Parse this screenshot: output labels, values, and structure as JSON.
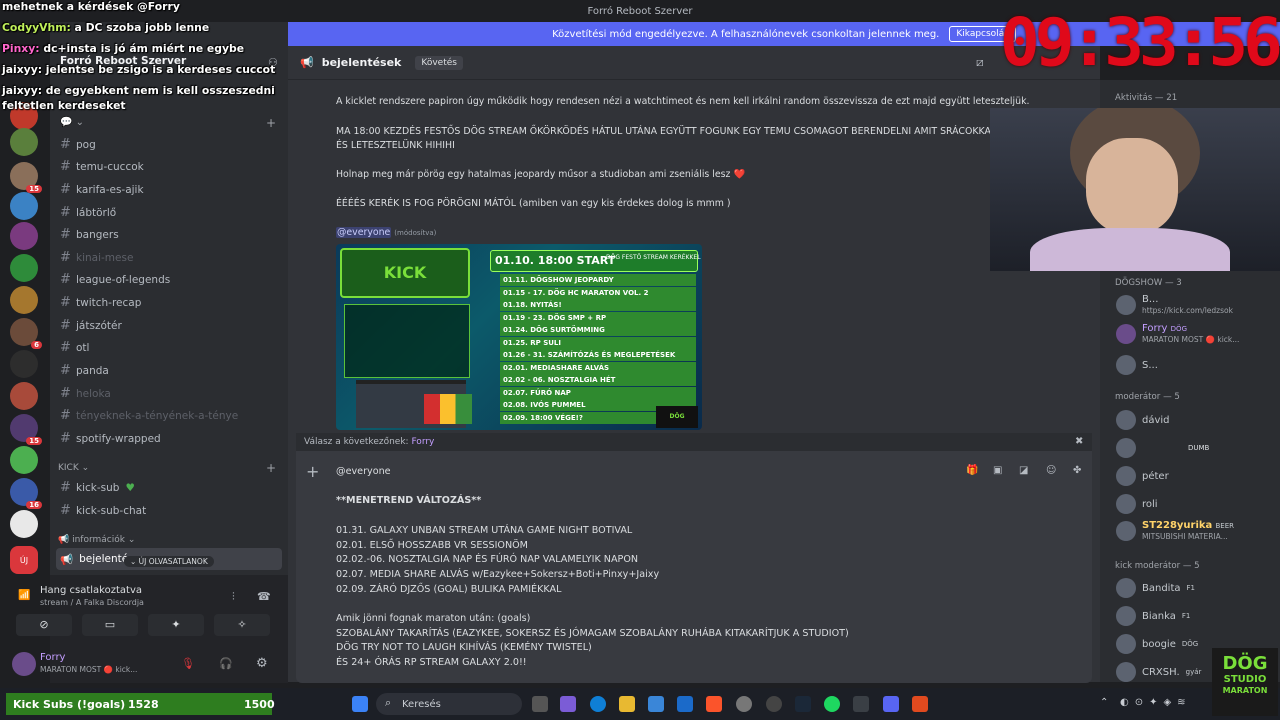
{
  "window": {
    "title": "Forró Reboot Szerver"
  },
  "banner": {
    "text": "Közvetítési mód engedélyezve. A felhasználónevek csonkoltan jelennek meg.",
    "button": "Kikapcsolás"
  },
  "overlay_chat": [
    {
      "text": "mehetnek a kérdések @Forry"
    },
    {
      "user": "CodyyVhm:",
      "text": " a DC szoba jobb lenne",
      "color": "#c0f05a"
    },
    {
      "user": "Pinxy:",
      "text": " dc+insta is jó ám miért ne egybe",
      "color": "#ff66cc"
    },
    {
      "user": "jaixyy:",
      "text": " jelentse be zsigo is a kerdeses cuccot",
      "color": "#ffffff"
    },
    {
      "user": "jaixyy:",
      "text": " de egyebkent nem is kell osszeszedni",
      "color": "#ffffff"
    },
    {
      "text": "feltetlen kerdeseket"
    }
  ],
  "clock": "09:33:56",
  "sidebar": {
    "server_name": "Forró Reboot Szerver",
    "category_kick": "KICK",
    "category_info": "információk",
    "channels": [
      {
        "name": "pog",
        "muted": false
      },
      {
        "name": "temu-cuccok",
        "muted": false
      },
      {
        "name": "karifa-es-ajik",
        "muted": false
      },
      {
        "name": "lábtörlő",
        "muted": false
      },
      {
        "name": "bangers",
        "muted": false
      },
      {
        "name": "kinai-mese",
        "muted": true
      },
      {
        "name": "league-of-legends",
        "muted": false
      },
      {
        "name": "twitch-recap",
        "muted": false
      },
      {
        "name": "játszótér",
        "muted": false
      },
      {
        "name": "otl",
        "muted": false
      },
      {
        "name": "panda",
        "muted": false
      },
      {
        "name": "heloka",
        "muted": true
      },
      {
        "name": "tényeknek-a-tényének-a-ténye",
        "muted": true
      },
      {
        "name": "spotify-wrapped",
        "muted": false
      }
    ],
    "kick_channels": [
      {
        "name": "kick-sub"
      },
      {
        "name": "kick-sub-chat"
      }
    ],
    "active_channel": "bejelenté",
    "unread_pill": "ÚJ OLVASATLANOK",
    "voice_status": "Hang csatlakoztatva",
    "voice_sub": "stream / A Falka Discordja",
    "user_name": "Forry",
    "user_status": "MARATON MOST 🔴 kick...",
    "server_badges": [
      "15",
      "6",
      "15",
      "16",
      "ÚJ"
    ]
  },
  "header": {
    "channel": "bejelentések",
    "follow": "Követés"
  },
  "messages": [
    "A kicklet rendszere papiron úgy működik hogy rendesen nézi a watchtimeot és nem kell irkálni random összevissza de ezt majd együtt leteszteljük.",
    "MA 18:00 KEZDÉS FESTŐS DÖG STREAM ŐKÖRKÖDÉS HÁTUL UTÁNA EGYÜTT FOGUNK EGY TEMU CSOMAGOT BERENDELNI AMIT SRÁCOKKAL",
    "ÉS LETESZTELÜNK HIHIHI",
    "Holnap meg már pörög egy hatalmas jeopardy műsor a studioban ami zseniális lesz ❤️",
    "ÉÉÉÉS KERÉK IS FOG PÖRÖGNI MÁTÓL (amiben van egy kis érdekes dolog is mmm )"
  ],
  "mention": {
    "text": "@everyone",
    "edited": "(módosítva)"
  },
  "schedule_image": {
    "logo": "KICK",
    "headline": "01.10. 18:00 START",
    "subhead": "DÖG FESTŐ STREAM KERÉKKEL",
    "items": [
      "01.11. DÖGSHOW JEOPARDY",
      "01.15 - 17. DÖG HC MARATON VOL. 2",
      "01.18. NYITÁS!",
      "01.19 - 23. DÖG SMP + RP",
      "01.24. DÖG SURTÖMMING",
      "01.25. RP SULI",
      "01.26 - 31. SZÁMÍTÓZÁS ÉS MEGLEPETÉSEK",
      "02.01. MEDIASHARE ALVÁS",
      "02.02 - 06. NOSZTALGIA HÉT",
      "02.07. FÚRÓ NAP",
      "02.08. IVÓS PUMMEL",
      "02.09. 18:00 VÉGE!?"
    ],
    "studio": "DÖG STUDIO"
  },
  "reply": {
    "label": "Válasz a következőnek:",
    "target": "Forry"
  },
  "composer_lines": [
    "@everyone",
    "",
    "**MENETREND VÁLTOZÁS**",
    "",
    "01.31. GALAXY UNBAN STREAM UTÁNA GAME NIGHT BOTIVAL",
    "02.01. ELSŐ HOSSZABB VR SESSIONÖM",
    "02.02.-06. NOSZTALGIA NAP ÉS FÚRÓ NAP VALAMELYIK NAPON",
    "02.07. MEDIA SHARE ALVÁS w/Eazykee+Sokersz+Boti+Pinxy+Jaixy",
    "02.09. ZÁRÓ DJZŐS (GOAL) BULIKA PAMIÉKKAL",
    "",
    "Amik jönni fognak maraton után: (goals)",
    "SZOBALÁNY TAKARÍTÁS (EAZYKEE, SOKERSZ ÉS JÓMAGAM SZOBALÁNY RUHÁBA KITAKARÍTJUK A STUDIOT)",
    "DÖG TRY NOT TO LAUGH KIHÍVÁS (KEMÉNY TWISTEL)",
    "ÉS 24+ ÓRÁS RP STREAM GALAXY 2.0!!"
  ],
  "members": {
    "activity": "Aktivitás — 21",
    "dogshow_header": "DÖGSHOW — 3",
    "dogshow": [
      {
        "name": "B...",
        "sub": "https://kick.com/ledzsok"
      },
      {
        "name": "Forry",
        "tag": "DÖG",
        "sub": "MARATON MOST 🔴 kick..."
      },
      {
        "name": "S..."
      }
    ],
    "mod_header": "moderátor — 5",
    "mods": [
      {
        "name": "dávid"
      },
      {
        "name": "",
        "tag": "DUMB"
      },
      {
        "name": "péter"
      },
      {
        "name": "roli"
      },
      {
        "name": "ST228yurika",
        "tag": "BEER",
        "sub": "MITSUBISHI MATERIA..."
      }
    ],
    "kickmod_header": "kick moderátor — 5",
    "kickmods": [
      {
        "name": "Bandita",
        "tag": "F1"
      },
      {
        "name": "Bianka",
        "tag": "F1"
      },
      {
        "name": "boogie",
        "tag": "DÖG"
      },
      {
        "name": "CRXSH.",
        "tag": "gyár"
      }
    ]
  },
  "taskbar": {
    "kick_subs_label": "Kick Subs (!goals)",
    "kick_subs_current": "1528",
    "kick_subs_goal": "1500",
    "search": "Keresés"
  },
  "stream_logo": [
    "DÖG",
    "STUDIO",
    "MARATON"
  ]
}
